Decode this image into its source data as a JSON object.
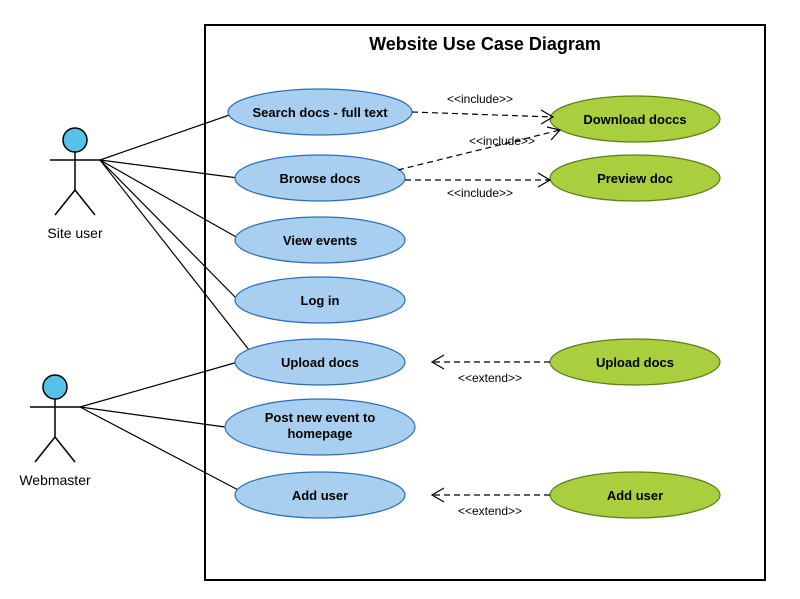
{
  "title": "Website Use Case Diagram",
  "actors": {
    "site_user": "Site user",
    "webmaster": "Webmaster"
  },
  "usecases": {
    "search_docs": "Search docs - full text",
    "browse_docs": "Browse docs",
    "view_events": "View events",
    "log_in": "Log in",
    "upload_docs": "Upload docs",
    "post_event": "Post new event to\nhomepage",
    "add_user": "Add user",
    "download_doccs": "Download doccs",
    "preview_doc": "Preview doc",
    "upload_docs_ext": "Upload docs",
    "add_user_ext": "Add user"
  },
  "stereotypes": {
    "include": "<<include>>",
    "extend": "<<extend>>"
  },
  "chart_data": {
    "type": "uml-use-case",
    "system": "Website",
    "actors": [
      "Site user",
      "Webmaster"
    ],
    "usecases_primary": [
      "Search docs - full text",
      "Browse docs",
      "View events",
      "Log in",
      "Upload docs",
      "Post new event to homepage",
      "Add user"
    ],
    "usecases_secondary": [
      "Download doccs",
      "Preview doc",
      "Upload docs",
      "Add user"
    ],
    "associations": [
      {
        "actor": "Site user",
        "usecase": "Search docs - full text"
      },
      {
        "actor": "Site user",
        "usecase": "Browse docs"
      },
      {
        "actor": "Site user",
        "usecase": "View events"
      },
      {
        "actor": "Site user",
        "usecase": "Log in"
      },
      {
        "actor": "Site user",
        "usecase": "Upload docs"
      },
      {
        "actor": "Webmaster",
        "usecase": "Upload docs"
      },
      {
        "actor": "Webmaster",
        "usecase": "Post new event to homepage"
      },
      {
        "actor": "Webmaster",
        "usecase": "Add user"
      }
    ],
    "dependencies": [
      {
        "from": "Search docs - full text",
        "to": "Download doccs",
        "type": "include"
      },
      {
        "from": "Browse docs",
        "to": "Download doccs",
        "type": "include"
      },
      {
        "from": "Browse docs",
        "to": "Preview doc",
        "type": "include"
      },
      {
        "from": "Upload docs (ext)",
        "to": "Upload docs",
        "type": "extend"
      },
      {
        "from": "Add user (ext)",
        "to": "Add user",
        "type": "extend"
      }
    ]
  }
}
